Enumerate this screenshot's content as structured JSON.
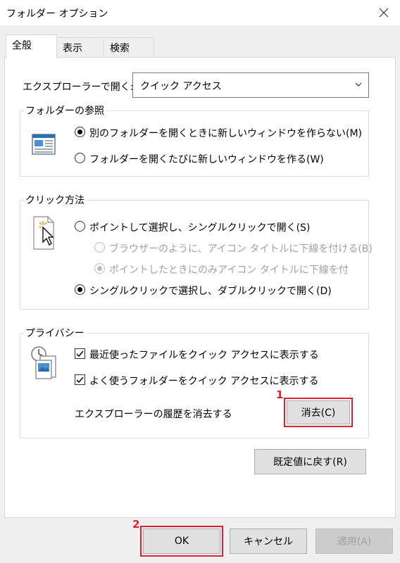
{
  "window": {
    "title": "フォルダー オプション",
    "close_icon": "close-icon"
  },
  "tabs": [
    {
      "label": "全般",
      "active": true
    },
    {
      "label": "表示",
      "active": false
    },
    {
      "label": "検索",
      "active": false
    }
  ],
  "general": {
    "open_explorer_label": "エクスプローラーで開く:",
    "open_explorer_value": "クイック アクセス",
    "browse_folders": {
      "legend": "フォルダーの参照",
      "icon": "folder-window-icon",
      "options": [
        {
          "label": "別のフォルダーを開くときに新しいウィンドウを作らない(M)",
          "checked": true
        },
        {
          "label": "フォルダーを開くたびに新しいウィンドウを作る(W)",
          "checked": false
        }
      ]
    },
    "click_items": {
      "legend": "クリック方法",
      "icon": "pointer-click-icon",
      "options": [
        {
          "label": "ポイントして選択し、シングルクリックで開く(S)",
          "checked": false,
          "disabled": false
        },
        {
          "label": "ブラウザーのように、アイコン タイトルに下線を付ける(B)",
          "checked": false,
          "disabled": true
        },
        {
          "label": "ポイントしたときにのみアイコン タイトルに下線を付ける(P",
          "checked": true,
          "disabled": true
        },
        {
          "label": "シングルクリックで選択し、ダブルクリックで開く(D)",
          "checked": true,
          "disabled": false
        }
      ]
    },
    "privacy": {
      "legend": "プライバシー",
      "icon": "recent-files-icon",
      "checks": [
        {
          "label": "最近使ったファイルをクイック アクセスに表示する",
          "checked": true
        },
        {
          "label": "よく使うフォルダーをクイック アクセスに表示する",
          "checked": true
        }
      ],
      "clear_history_label": "エクスプローラーの履歴を消去する",
      "clear_button": "消去(C)"
    },
    "restore_defaults_button": "既定値に戻す(R)"
  },
  "footer": {
    "ok_button": "OK",
    "cancel_button": "キャンセル",
    "apply_button": "適用(A)"
  },
  "annotations": {
    "marker_1": "1",
    "marker_2": "2",
    "highlight_color": "#e0222e"
  }
}
